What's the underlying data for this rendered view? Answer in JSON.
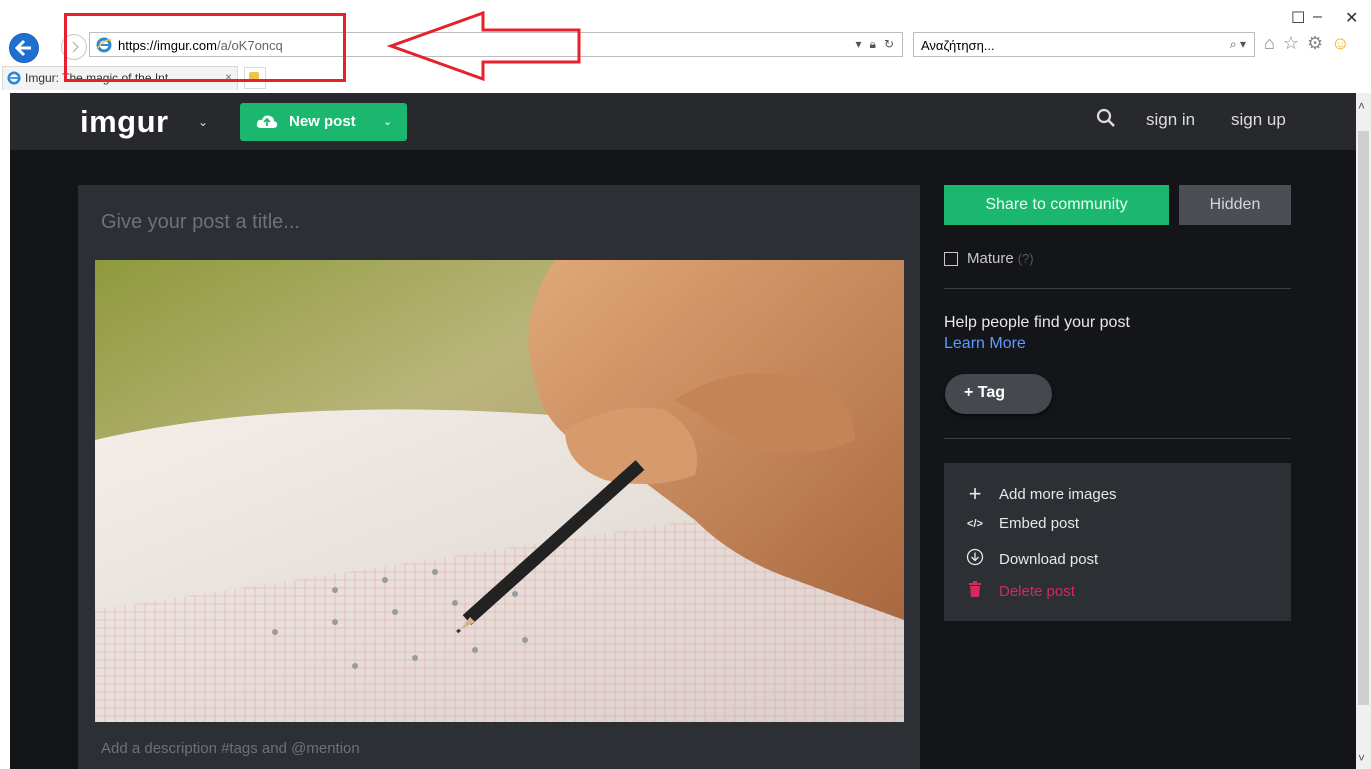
{
  "browser": {
    "url_host": "https://imgur.com",
    "url_path": "/a/oK7oncq",
    "search_placeholder": "Αναζήτηση...",
    "tab_title": "Imgur: The magic of the Int...",
    "tab_close": "×",
    "minimize": "–",
    "maximize": "☐",
    "close": "✕"
  },
  "topbar": {
    "logo": "imgur",
    "new_post_label": "New post",
    "sign_in": "sign in",
    "sign_up": "sign up"
  },
  "editor": {
    "title_placeholder": "Give your post a title...",
    "description_placeholder": "Add a description #tags and @mention"
  },
  "sidebar": {
    "share_label": "Share to community",
    "hidden_label": "Hidden",
    "mature_label": "Mature",
    "mature_help": "(?)",
    "help_text": "Help people find your post",
    "learn_more": "Learn More",
    "tag_label": "+ Tag",
    "actions": [
      {
        "label": "Add more images",
        "icon": "plus-icon"
      },
      {
        "label": "Embed post",
        "icon": "code-icon"
      },
      {
        "label": "Download post",
        "icon": "download-icon"
      },
      {
        "label": "Delete post",
        "icon": "trash-icon"
      }
    ]
  },
  "colors": {
    "accent_green": "#1bb76e",
    "delete_red": "#d42a5c",
    "annotation_red": "#e5222b"
  }
}
